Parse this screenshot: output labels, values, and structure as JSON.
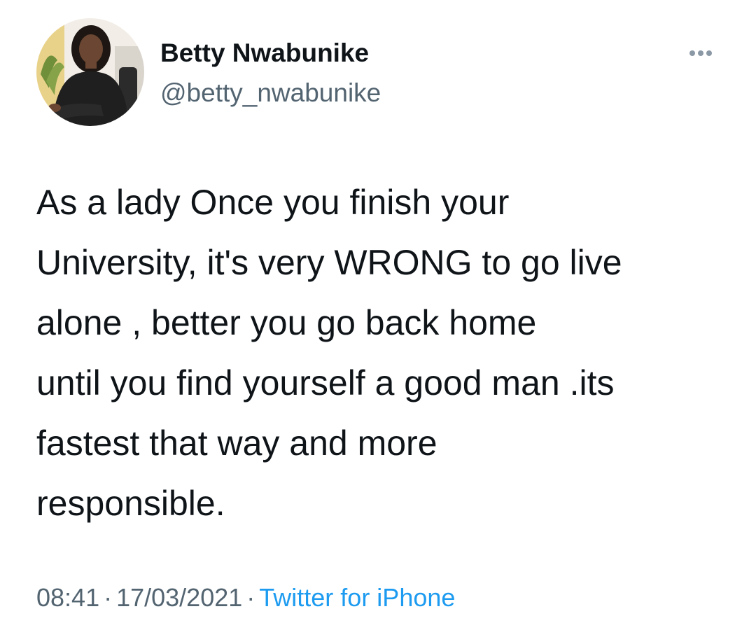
{
  "tweet": {
    "author": {
      "display_name": "Betty Nwabunike",
      "handle": "@betty_nwabunike",
      "avatar_icon": "profile-photo"
    },
    "more_icon": "more-options-icon",
    "text": "As a lady Once you finish your\nUniversity, it's very WRONG to go live\nalone ,  better you go back home\nuntil you find yourself a good man .its\nfastest that way and more\nresponsible.",
    "meta": {
      "time": "08:41",
      "separator": "·",
      "date": "17/03/2021",
      "source": "Twitter for iPhone"
    }
  },
  "colors": {
    "text_primary": "#0f1419",
    "text_secondary": "#536471",
    "link": "#1d9bf0",
    "background": "#ffffff"
  }
}
